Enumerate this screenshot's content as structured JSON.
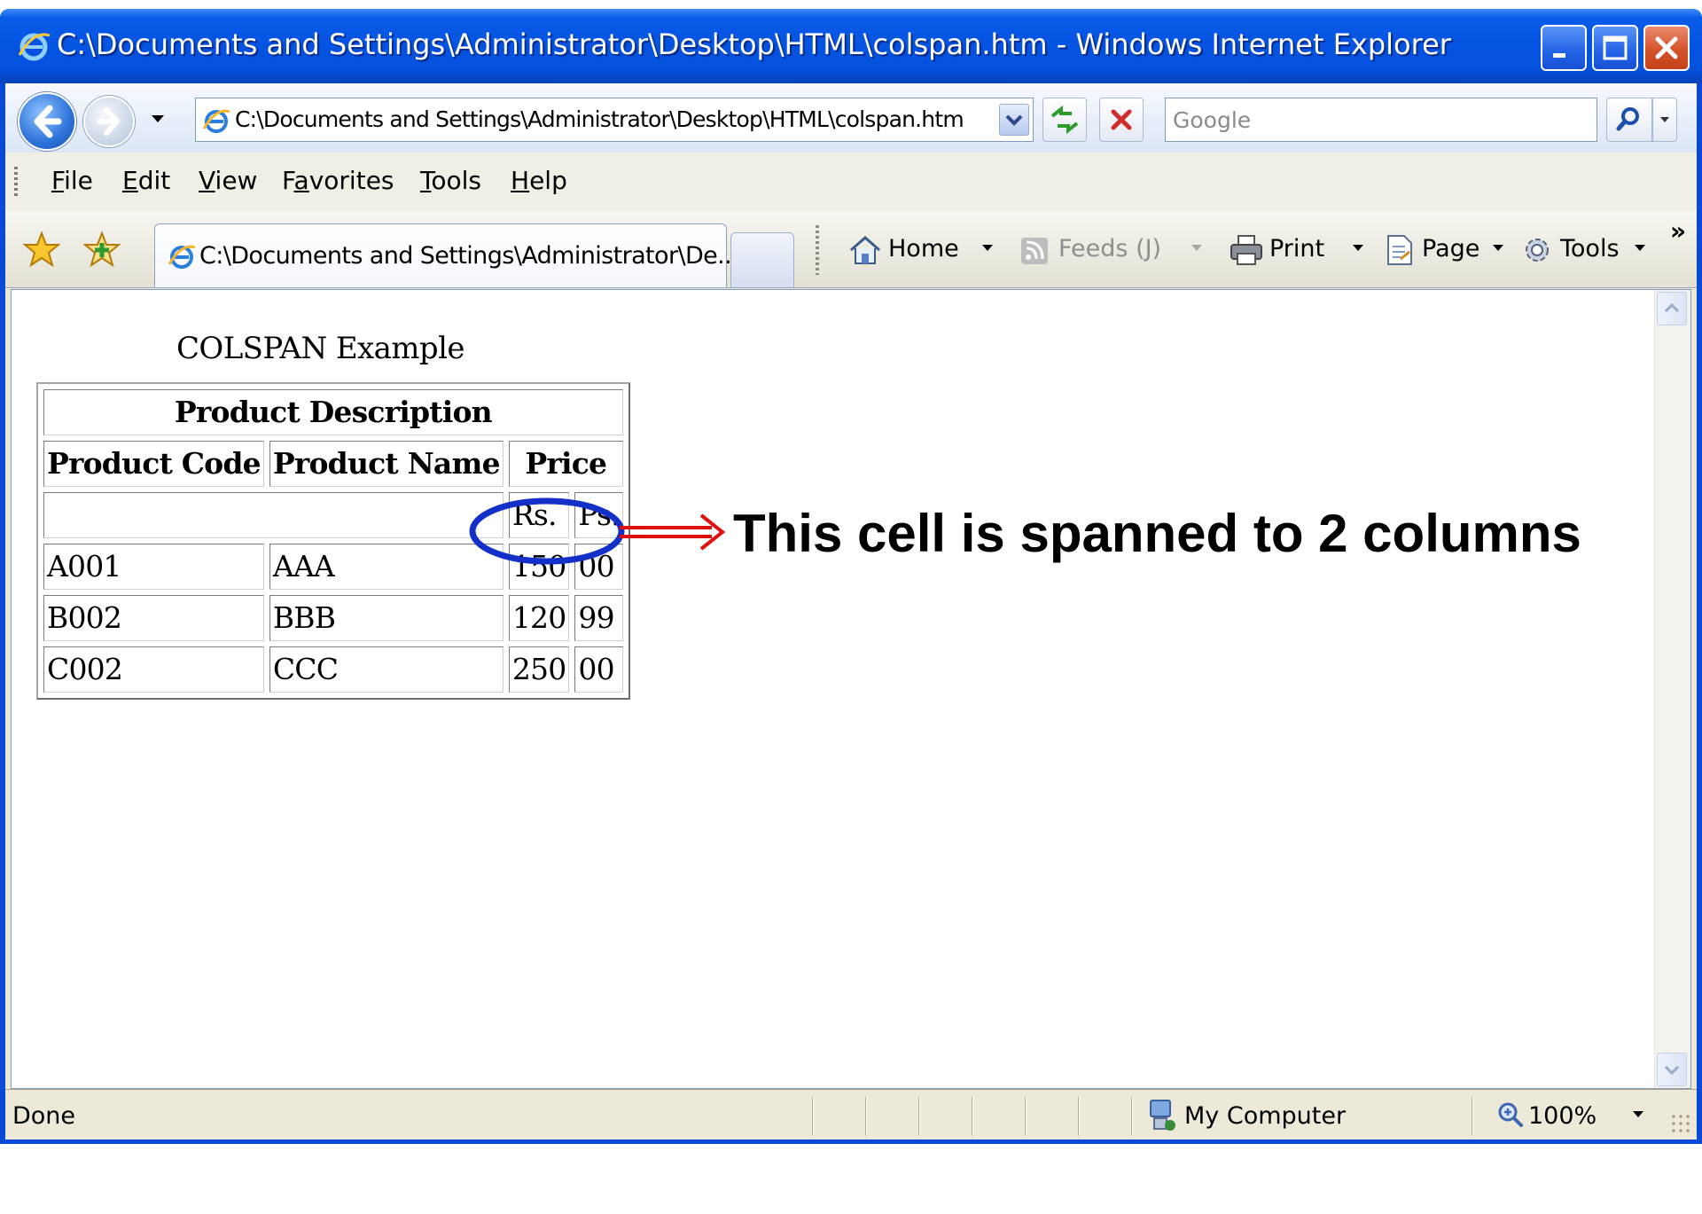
{
  "window": {
    "title": "C:\\Documents and Settings\\Administrator\\Desktop\\HTML\\colspan.htm - Windows Internet Explorer",
    "controls": [
      "minimize-icon",
      "maximize-icon",
      "close-icon"
    ]
  },
  "address_bar": {
    "url": "C:\\Documents and Settings\\Administrator\\Desktop\\HTML\\colspan.htm",
    "search_placeholder": "Google"
  },
  "menu": {
    "items": [
      {
        "label": "File",
        "accel": "F",
        "rest": "ile"
      },
      {
        "label": "Edit",
        "accel": "E",
        "rest": "dit"
      },
      {
        "label": "View",
        "accel": "V",
        "rest": "iew"
      },
      {
        "label": "Favorites",
        "lead": "F",
        "accel": "a",
        "rest": "vorites"
      },
      {
        "label": "Tools",
        "accel": "T",
        "rest": "ools"
      },
      {
        "label": "Help",
        "accel": "H",
        "rest": "elp"
      }
    ]
  },
  "tabs": {
    "active_title": "C:\\Documents and Settings\\Administrator\\De..."
  },
  "command_bar": {
    "home": "Home",
    "feeds": "Feeds (J)",
    "print": "Print",
    "page": "Page",
    "tools": "Tools",
    "more": "»"
  },
  "page": {
    "heading": "COLSPAN Example",
    "table": {
      "caption_row": "Product Description",
      "headers": [
        "Product Code",
        "Product Name",
        "Price"
      ],
      "subheaders": [
        "Rs.",
        "Ps."
      ],
      "rows": [
        [
          "A001",
          "AAA",
          "150",
          "00"
        ],
        [
          "B002",
          "BBB",
          "120",
          "99"
        ],
        [
          "C002",
          "CCC",
          "250",
          "00"
        ]
      ]
    },
    "annotation": "This cell is spanned to 2 columns",
    "colors": {
      "highlight": "#1330c8",
      "arrow": "#e01010"
    }
  },
  "status_bar": {
    "text": "Done",
    "zone": "My Computer",
    "zoom": "100%"
  }
}
